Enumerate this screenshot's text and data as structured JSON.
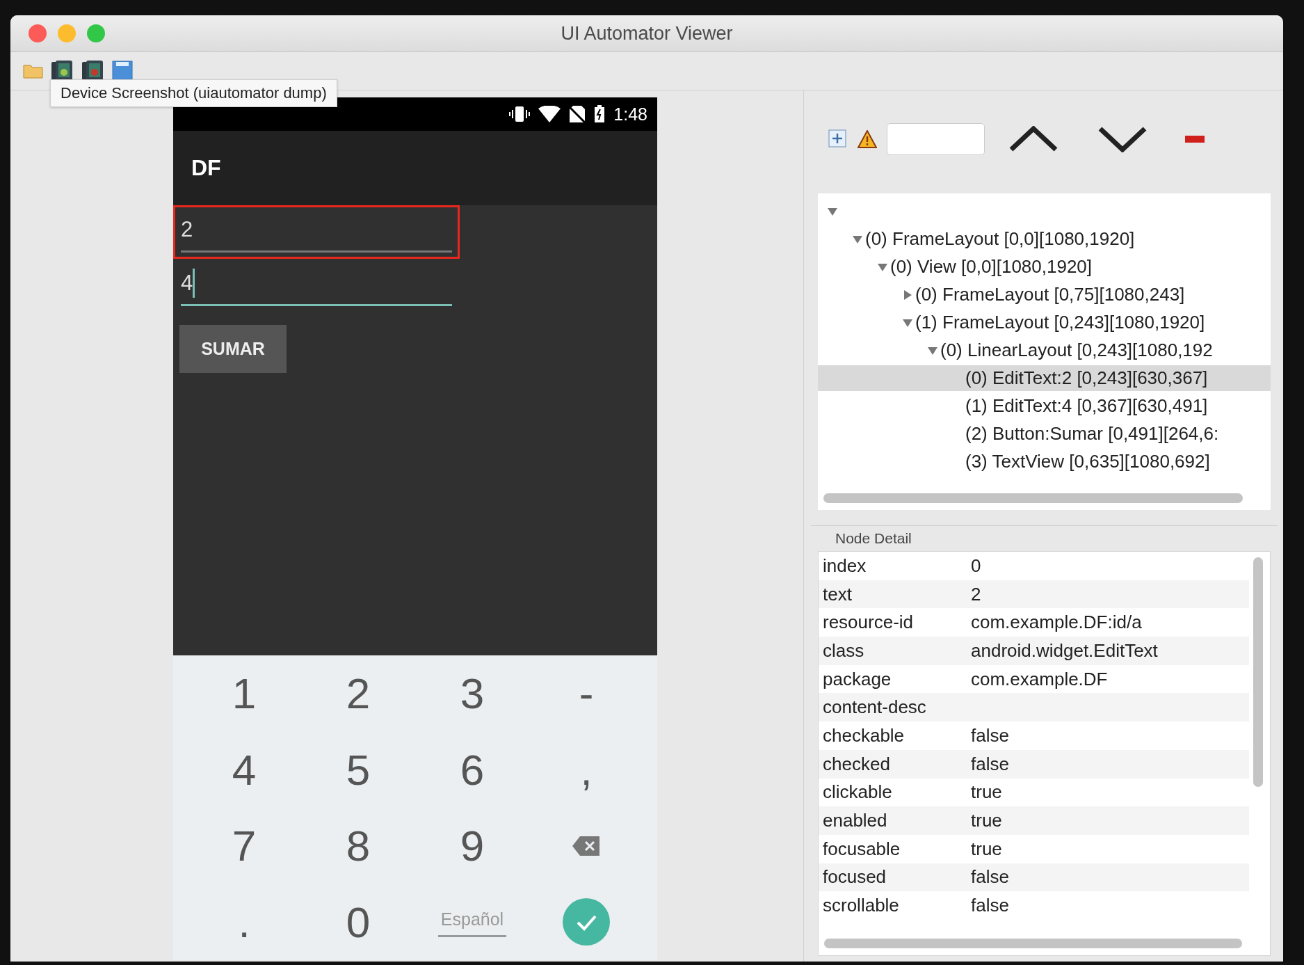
{
  "window": {
    "title": "UI Automator Viewer"
  },
  "toolbar": {
    "tooltip": "Device Screenshot (uiautomator dump)"
  },
  "device": {
    "status_bar": {
      "time": "1:48"
    },
    "app_title": "DF",
    "fields": [
      {
        "value": "2",
        "highlighted": true,
        "focused": false
      },
      {
        "value": "4",
        "highlighted": false,
        "focused": true
      }
    ],
    "button": "SUMAR",
    "keyboard": [
      {
        "kind": "text",
        "label": "1"
      },
      {
        "kind": "text",
        "label": "2"
      },
      {
        "kind": "text",
        "label": "3"
      },
      {
        "kind": "text",
        "label": "-"
      },
      {
        "kind": "text",
        "label": "4"
      },
      {
        "kind": "text",
        "label": "5"
      },
      {
        "kind": "text",
        "label": "6"
      },
      {
        "kind": "text",
        "label": ","
      },
      {
        "kind": "text",
        "label": "7"
      },
      {
        "kind": "text",
        "label": "8"
      },
      {
        "kind": "text",
        "label": "9"
      },
      {
        "kind": "backspace"
      },
      {
        "kind": "text",
        "label": "."
      },
      {
        "kind": "text",
        "label": "0"
      },
      {
        "kind": "language",
        "label": "Español"
      },
      {
        "kind": "enter"
      }
    ]
  },
  "tree": {
    "nodes": [
      {
        "expanded": true,
        "selected": false,
        "children": [
          {
            "label": "(0) FrameLayout [0,0][1080,1920]",
            "expanded": true,
            "selected": false,
            "children": [
              {
                "label": "(0) View [0,0][1080,1920]",
                "expanded": true,
                "selected": false,
                "children": [
                  {
                    "label": "(0) FrameLayout [0,75][1080,243]",
                    "expanded": false,
                    "selected": false
                  },
                  {
                    "label": "(1) FrameLayout [0,243][1080,1920]",
                    "expanded": true,
                    "selected": false,
                    "children": [
                      {
                        "label": "(0) LinearLayout [0,243][1080,192",
                        "expanded": true,
                        "selected": false,
                        "children": [
                          {
                            "label": "(0) EditText:2 [0,243][630,367]",
                            "selected": true
                          },
                          {
                            "label": "(1) EditText:4 [0,367][630,491]",
                            "selected": false
                          },
                          {
                            "label": "(2) Button:Sumar [0,491][264,6:",
                            "selected": false
                          },
                          {
                            "label": "(3) TextView [0,635][1080,692]",
                            "selected": false
                          }
                        ]
                      }
                    ]
                  }
                ]
              }
            ]
          }
        ]
      }
    ]
  },
  "node_detail": {
    "title": "Node Detail",
    "rows": [
      {
        "key": "index",
        "value": "0"
      },
      {
        "key": "text",
        "value": "2"
      },
      {
        "key": "resource-id",
        "value": "com.example.DF:id/a"
      },
      {
        "key": "class",
        "value": "android.widget.EditText"
      },
      {
        "key": "package",
        "value": "com.example.DF"
      },
      {
        "key": "content-desc"
      },
      {
        "key": "checkable",
        "value": "false"
      },
      {
        "key": "checked",
        "value": "false"
      },
      {
        "key": "clickable",
        "value": "true"
      },
      {
        "key": "enabled",
        "value": "true"
      },
      {
        "key": "focusable",
        "value": "true"
      },
      {
        "key": "focused",
        "value": "false"
      },
      {
        "key": "scrollable",
        "value": "false"
      }
    ]
  }
}
